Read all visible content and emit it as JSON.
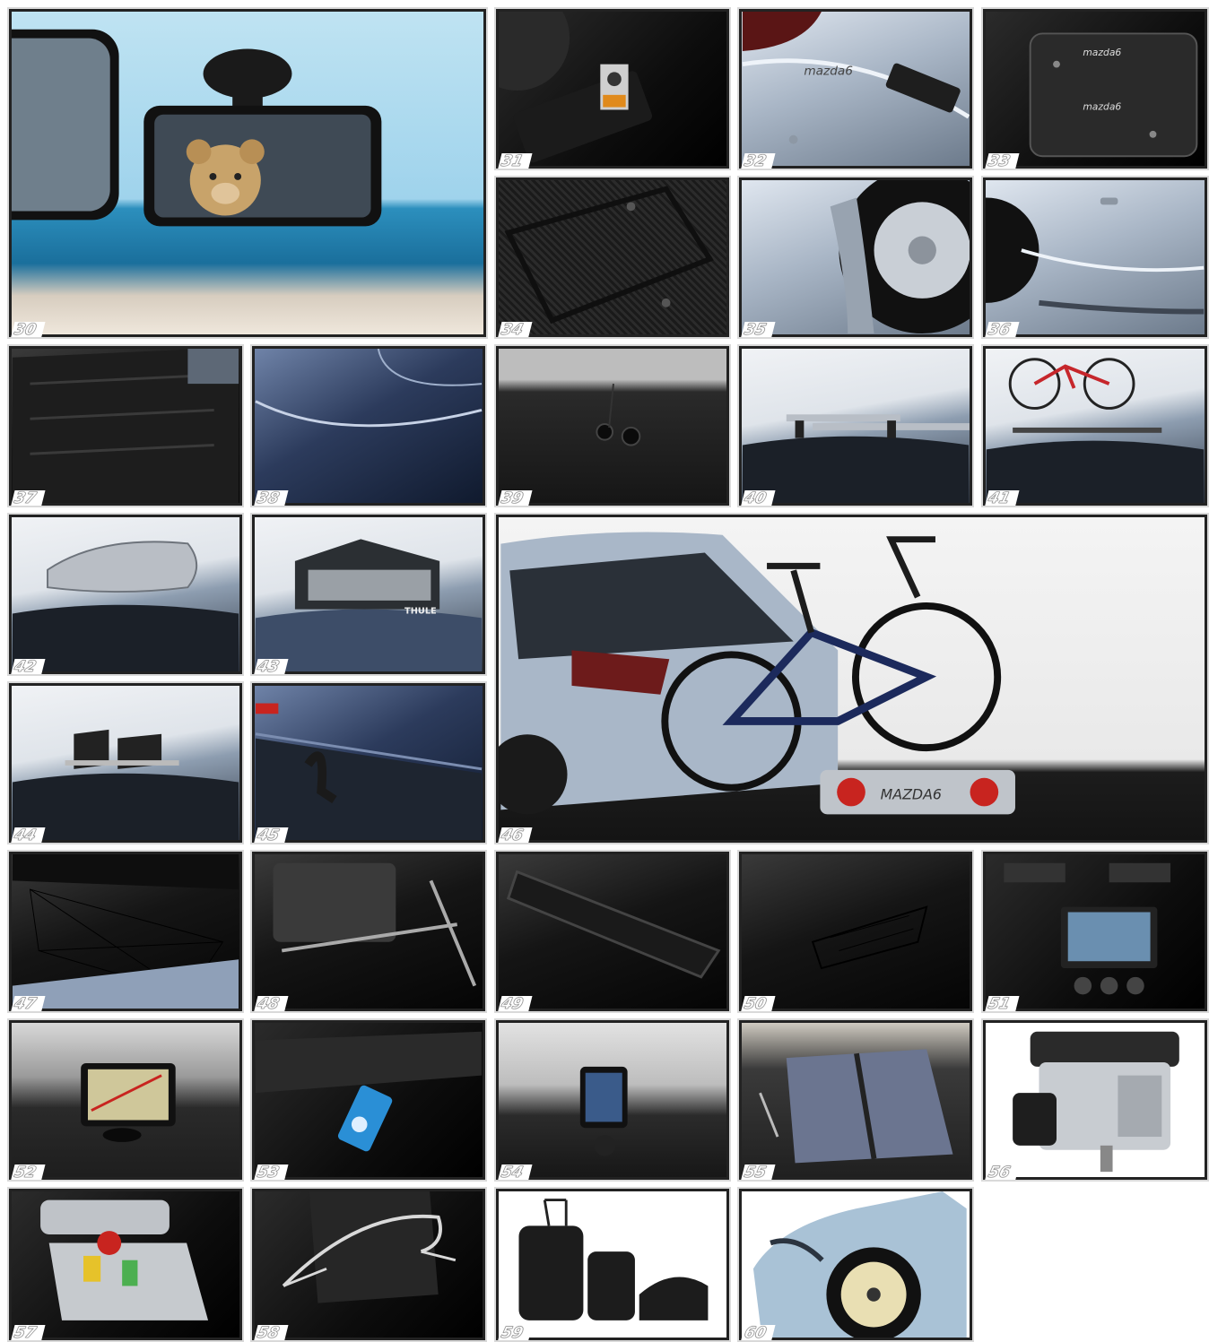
{
  "tiles": [
    {
      "id": "30",
      "label": "30",
      "theme": "beach",
      "desc": "child-mirror-icon"
    },
    {
      "id": "31",
      "label": "31",
      "theme": "darker",
      "desc": "interior-panel-icon"
    },
    {
      "id": "32",
      "label": "32",
      "theme": "silver",
      "desc": "rear-badge-icon"
    },
    {
      "id": "33",
      "label": "33",
      "theme": "darker",
      "desc": "textile-mat-icon"
    },
    {
      "id": "34",
      "label": "34",
      "theme": "dark",
      "desc": "rubber-mat-icon"
    },
    {
      "id": "35",
      "label": "35",
      "theme": "silver",
      "desc": "mud-flap-icon"
    },
    {
      "id": "36",
      "label": "36",
      "theme": "silver",
      "desc": "side-moulding-icon"
    },
    {
      "id": "37",
      "label": "37",
      "theme": "dark",
      "desc": "boot-liner-icon"
    },
    {
      "id": "38",
      "label": "38",
      "theme": "paint",
      "desc": "paint-protection-icon"
    },
    {
      "id": "39",
      "label": "39",
      "theme": "dark",
      "desc": "hook-icon"
    },
    {
      "id": "40",
      "label": "40",
      "theme": "bluecar",
      "desc": "roof-bars-icon"
    },
    {
      "id": "41",
      "label": "41",
      "theme": "bluecar",
      "desc": "roof-bike-carrier-icon"
    },
    {
      "id": "42",
      "label": "42",
      "theme": "bluecar",
      "desc": "roof-box-icon"
    },
    {
      "id": "43",
      "label": "43",
      "theme": "bluecar",
      "desc": "roof-bag-icon"
    },
    {
      "id": "44",
      "label": "44",
      "theme": "bluecar",
      "desc": "ski-carrier-icon"
    },
    {
      "id": "45",
      "label": "45",
      "theme": "paint",
      "desc": "towbar-icon"
    },
    {
      "id": "46",
      "label": "46",
      "theme": "bike",
      "desc": "rear-bike-carrier-icon"
    },
    {
      "id": "47",
      "label": "47",
      "theme": "dark",
      "desc": "cargo-net-icon"
    },
    {
      "id": "48",
      "label": "48",
      "theme": "dark",
      "desc": "boot-divider-icon"
    },
    {
      "id": "49",
      "label": "49",
      "theme": "dark",
      "desc": "storage-tray-icon"
    },
    {
      "id": "50",
      "label": "50",
      "theme": "dark",
      "desc": "side-net-icon"
    },
    {
      "id": "51",
      "label": "51",
      "theme": "darker",
      "desc": "navigation-unit-icon"
    },
    {
      "id": "52",
      "label": "52",
      "theme": "dark",
      "desc": "portable-nav-icon"
    },
    {
      "id": "53",
      "label": "53",
      "theme": "darker",
      "desc": "media-player-icon"
    },
    {
      "id": "54",
      "label": "54",
      "theme": "dark",
      "desc": "bluetooth-display-icon"
    },
    {
      "id": "55",
      "label": "55",
      "theme": "dark",
      "desc": "sun-shade-icon"
    },
    {
      "id": "56",
      "label": "56",
      "theme": "white",
      "desc": "heater-icon"
    },
    {
      "id": "57",
      "label": "57",
      "theme": "darker",
      "desc": "cool-box-icon"
    },
    {
      "id": "58",
      "label": "58",
      "theme": "darker",
      "desc": "coat-hanger-icon"
    },
    {
      "id": "59",
      "label": "59",
      "theme": "white",
      "desc": "luggage-set-icon"
    },
    {
      "id": "60",
      "label": "60",
      "theme": "white",
      "desc": "space-saver-wheel-icon"
    }
  ],
  "badges": {
    "brand_box": "THULE",
    "plate": "MAZDA6",
    "badge": "mazda6"
  },
  "colors": {
    "border": "#d9d9d9",
    "label": "#ffffff",
    "accent_red": "#c8241f",
    "sea": "#2f8fc0"
  }
}
